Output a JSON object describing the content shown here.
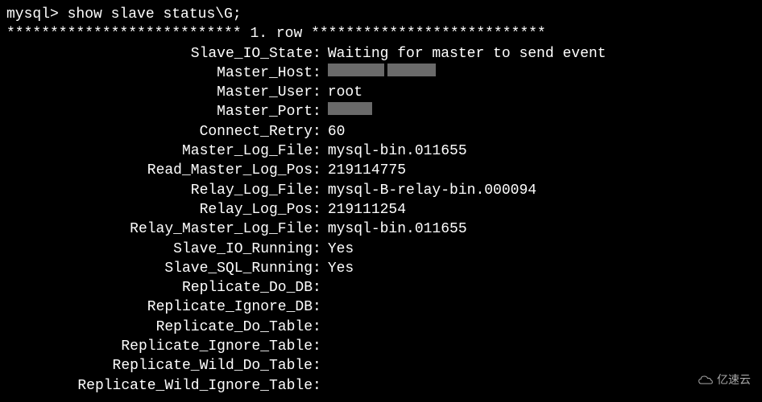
{
  "terminal": {
    "prompt": "mysql> ",
    "command": "show slave status\\G;",
    "separator_left": "*************************** ",
    "row_label": "1. row ",
    "separator_right": "***************************"
  },
  "status": {
    "rows": [
      {
        "key": "Slave_IO_State",
        "value": "Waiting for master to send event"
      },
      {
        "key": "Master_Host",
        "value": "",
        "redacted": "double"
      },
      {
        "key": "Master_User",
        "value": "root"
      },
      {
        "key": "Master_Port",
        "value": "",
        "redacted": "single"
      },
      {
        "key": "Connect_Retry",
        "value": "60"
      },
      {
        "key": "Master_Log_File",
        "value": "mysql-bin.011655"
      },
      {
        "key": "Read_Master_Log_Pos",
        "value": "219114775"
      },
      {
        "key": "Relay_Log_File",
        "value": "mysql-B-relay-bin.000094"
      },
      {
        "key": "Relay_Log_Pos",
        "value": "219111254"
      },
      {
        "key": "Relay_Master_Log_File",
        "value": "mysql-bin.011655"
      },
      {
        "key": "Slave_IO_Running",
        "value": "Yes"
      },
      {
        "key": "Slave_SQL_Running",
        "value": "Yes"
      },
      {
        "key": "Replicate_Do_DB",
        "value": ""
      },
      {
        "key": "Replicate_Ignore_DB",
        "value": ""
      },
      {
        "key": "Replicate_Do_Table",
        "value": ""
      },
      {
        "key": "Replicate_Ignore_Table",
        "value": ""
      },
      {
        "key": "Replicate_Wild_Do_Table",
        "value": ""
      },
      {
        "key": "Replicate_Wild_Ignore_Table",
        "value": ""
      }
    ]
  },
  "watermark": {
    "text": "亿速云"
  }
}
